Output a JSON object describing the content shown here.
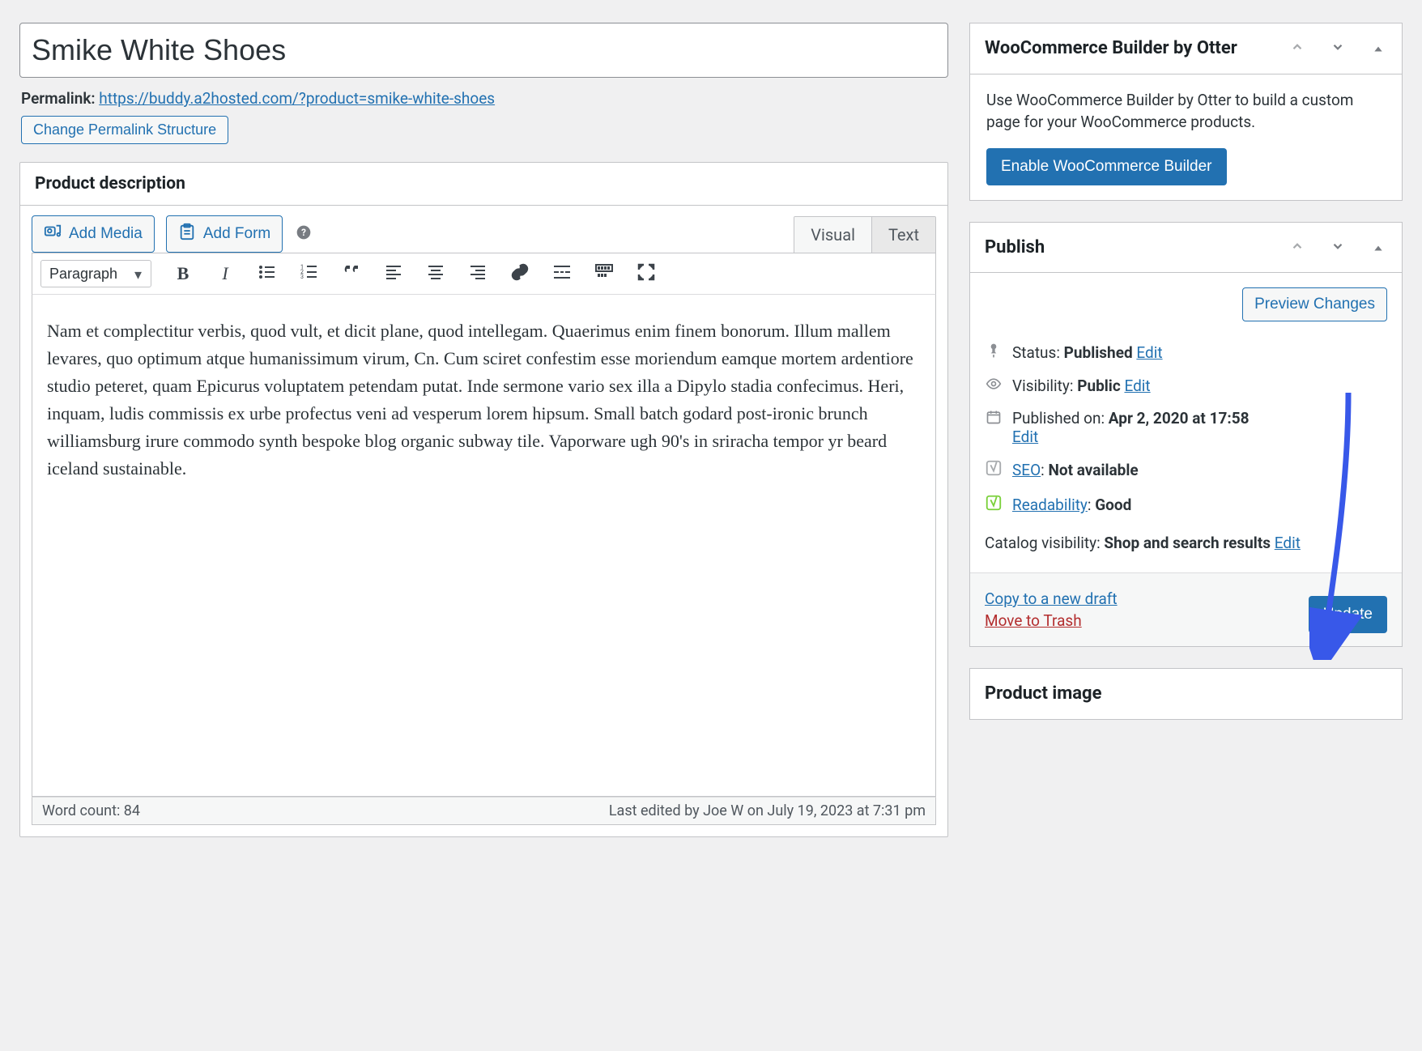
{
  "title": "Smike White Shoes",
  "permalink": {
    "label": "Permalink:",
    "url_text": "https://buddy.a2hosted.com/?product=smike-white-shoes",
    "change_btn": "Change Permalink Structure"
  },
  "description_box": {
    "heading": "Product description",
    "add_media": "Add Media",
    "add_form": "Add Form",
    "tab_visual": "Visual",
    "tab_text": "Text",
    "format_select": "Paragraph",
    "body": "Nam et complectitur verbis, quod vult, et dicit plane, quod intellegam. Quaerimus enim finem bonorum. Illum mallem levares, quo optimum atque humanissimum virum, Cn. Cum sciret confestim esse moriendum eamque mortem ardentiore studio peteret, quam Epicurus voluptatem petendam putat. Inde sermone vario sex illa a Dipylo stadia confecimus. Heri, inquam, ludis commissis ex urbe profectus veni ad vesperum lorem hipsum. Small batch godard post-ironic brunch williamsburg irure commodo synth bespoke blog organic subway tile. Vaporware ugh 90's in sriracha tempor yr beard iceland sustainable.",
    "word_count_label": "Word count: ",
    "word_count": "84",
    "last_edited": "Last edited by Joe W on July 19, 2023 at 7:31 pm"
  },
  "woocommerce_box": {
    "heading": "WooCommerce Builder by Otter",
    "desc": "Use WooCommerce Builder by Otter to build a custom page for your WooCommerce products.",
    "enable_btn": "Enable WooCommerce Builder"
  },
  "publish_box": {
    "heading": "Publish",
    "preview_btn": "Preview Changes",
    "status_label": "Status:",
    "status_value": "Published",
    "visibility_label": "Visibility:",
    "visibility_value": "Public",
    "published_label": "Published on:",
    "published_value": "Apr 2, 2020 at 17:58",
    "seo_label": "SEO",
    "seo_value": "Not available",
    "readability_label": "Readability",
    "readability_value": "Good",
    "catalog_label": "Catalog visibility:",
    "catalog_value": "Shop and search results",
    "edit": "Edit",
    "copy_draft": "Copy to a new draft",
    "move_trash": "Move to Trash",
    "update_btn": "Update"
  },
  "product_image_box": {
    "heading": "Product image"
  }
}
